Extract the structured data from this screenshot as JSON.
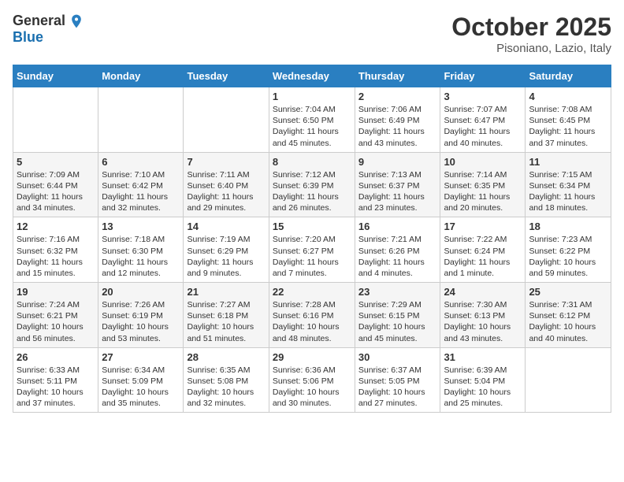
{
  "logo": {
    "general": "General",
    "blue": "Blue"
  },
  "title": "October 2025",
  "location": "Pisoniano, Lazio, Italy",
  "weekdays": [
    "Sunday",
    "Monday",
    "Tuesday",
    "Wednesday",
    "Thursday",
    "Friday",
    "Saturday"
  ],
  "weeks": [
    [
      {
        "day": "",
        "info": ""
      },
      {
        "day": "",
        "info": ""
      },
      {
        "day": "",
        "info": ""
      },
      {
        "day": "1",
        "info": "Sunrise: 7:04 AM\nSunset: 6:50 PM\nDaylight: 11 hours and 45 minutes."
      },
      {
        "day": "2",
        "info": "Sunrise: 7:06 AM\nSunset: 6:49 PM\nDaylight: 11 hours and 43 minutes."
      },
      {
        "day": "3",
        "info": "Sunrise: 7:07 AM\nSunset: 6:47 PM\nDaylight: 11 hours and 40 minutes."
      },
      {
        "day": "4",
        "info": "Sunrise: 7:08 AM\nSunset: 6:45 PM\nDaylight: 11 hours and 37 minutes."
      }
    ],
    [
      {
        "day": "5",
        "info": "Sunrise: 7:09 AM\nSunset: 6:44 PM\nDaylight: 11 hours and 34 minutes."
      },
      {
        "day": "6",
        "info": "Sunrise: 7:10 AM\nSunset: 6:42 PM\nDaylight: 11 hours and 32 minutes."
      },
      {
        "day": "7",
        "info": "Sunrise: 7:11 AM\nSunset: 6:40 PM\nDaylight: 11 hours and 29 minutes."
      },
      {
        "day": "8",
        "info": "Sunrise: 7:12 AM\nSunset: 6:39 PM\nDaylight: 11 hours and 26 minutes."
      },
      {
        "day": "9",
        "info": "Sunrise: 7:13 AM\nSunset: 6:37 PM\nDaylight: 11 hours and 23 minutes."
      },
      {
        "day": "10",
        "info": "Sunrise: 7:14 AM\nSunset: 6:35 PM\nDaylight: 11 hours and 20 minutes."
      },
      {
        "day": "11",
        "info": "Sunrise: 7:15 AM\nSunset: 6:34 PM\nDaylight: 11 hours and 18 minutes."
      }
    ],
    [
      {
        "day": "12",
        "info": "Sunrise: 7:16 AM\nSunset: 6:32 PM\nDaylight: 11 hours and 15 minutes."
      },
      {
        "day": "13",
        "info": "Sunrise: 7:18 AM\nSunset: 6:30 PM\nDaylight: 11 hours and 12 minutes."
      },
      {
        "day": "14",
        "info": "Sunrise: 7:19 AM\nSunset: 6:29 PM\nDaylight: 11 hours and 9 minutes."
      },
      {
        "day": "15",
        "info": "Sunrise: 7:20 AM\nSunset: 6:27 PM\nDaylight: 11 hours and 7 minutes."
      },
      {
        "day": "16",
        "info": "Sunrise: 7:21 AM\nSunset: 6:26 PM\nDaylight: 11 hours and 4 minutes."
      },
      {
        "day": "17",
        "info": "Sunrise: 7:22 AM\nSunset: 6:24 PM\nDaylight: 11 hours and 1 minute."
      },
      {
        "day": "18",
        "info": "Sunrise: 7:23 AM\nSunset: 6:22 PM\nDaylight: 10 hours and 59 minutes."
      }
    ],
    [
      {
        "day": "19",
        "info": "Sunrise: 7:24 AM\nSunset: 6:21 PM\nDaylight: 10 hours and 56 minutes."
      },
      {
        "day": "20",
        "info": "Sunrise: 7:26 AM\nSunset: 6:19 PM\nDaylight: 10 hours and 53 minutes."
      },
      {
        "day": "21",
        "info": "Sunrise: 7:27 AM\nSunset: 6:18 PM\nDaylight: 10 hours and 51 minutes."
      },
      {
        "day": "22",
        "info": "Sunrise: 7:28 AM\nSunset: 6:16 PM\nDaylight: 10 hours and 48 minutes."
      },
      {
        "day": "23",
        "info": "Sunrise: 7:29 AM\nSunset: 6:15 PM\nDaylight: 10 hours and 45 minutes."
      },
      {
        "day": "24",
        "info": "Sunrise: 7:30 AM\nSunset: 6:13 PM\nDaylight: 10 hours and 43 minutes."
      },
      {
        "day": "25",
        "info": "Sunrise: 7:31 AM\nSunset: 6:12 PM\nDaylight: 10 hours and 40 minutes."
      }
    ],
    [
      {
        "day": "26",
        "info": "Sunrise: 6:33 AM\nSunset: 5:11 PM\nDaylight: 10 hours and 37 minutes."
      },
      {
        "day": "27",
        "info": "Sunrise: 6:34 AM\nSunset: 5:09 PM\nDaylight: 10 hours and 35 minutes."
      },
      {
        "day": "28",
        "info": "Sunrise: 6:35 AM\nSunset: 5:08 PM\nDaylight: 10 hours and 32 minutes."
      },
      {
        "day": "29",
        "info": "Sunrise: 6:36 AM\nSunset: 5:06 PM\nDaylight: 10 hours and 30 minutes."
      },
      {
        "day": "30",
        "info": "Sunrise: 6:37 AM\nSunset: 5:05 PM\nDaylight: 10 hours and 27 minutes."
      },
      {
        "day": "31",
        "info": "Sunrise: 6:39 AM\nSunset: 5:04 PM\nDaylight: 10 hours and 25 minutes."
      },
      {
        "day": "",
        "info": ""
      }
    ]
  ]
}
